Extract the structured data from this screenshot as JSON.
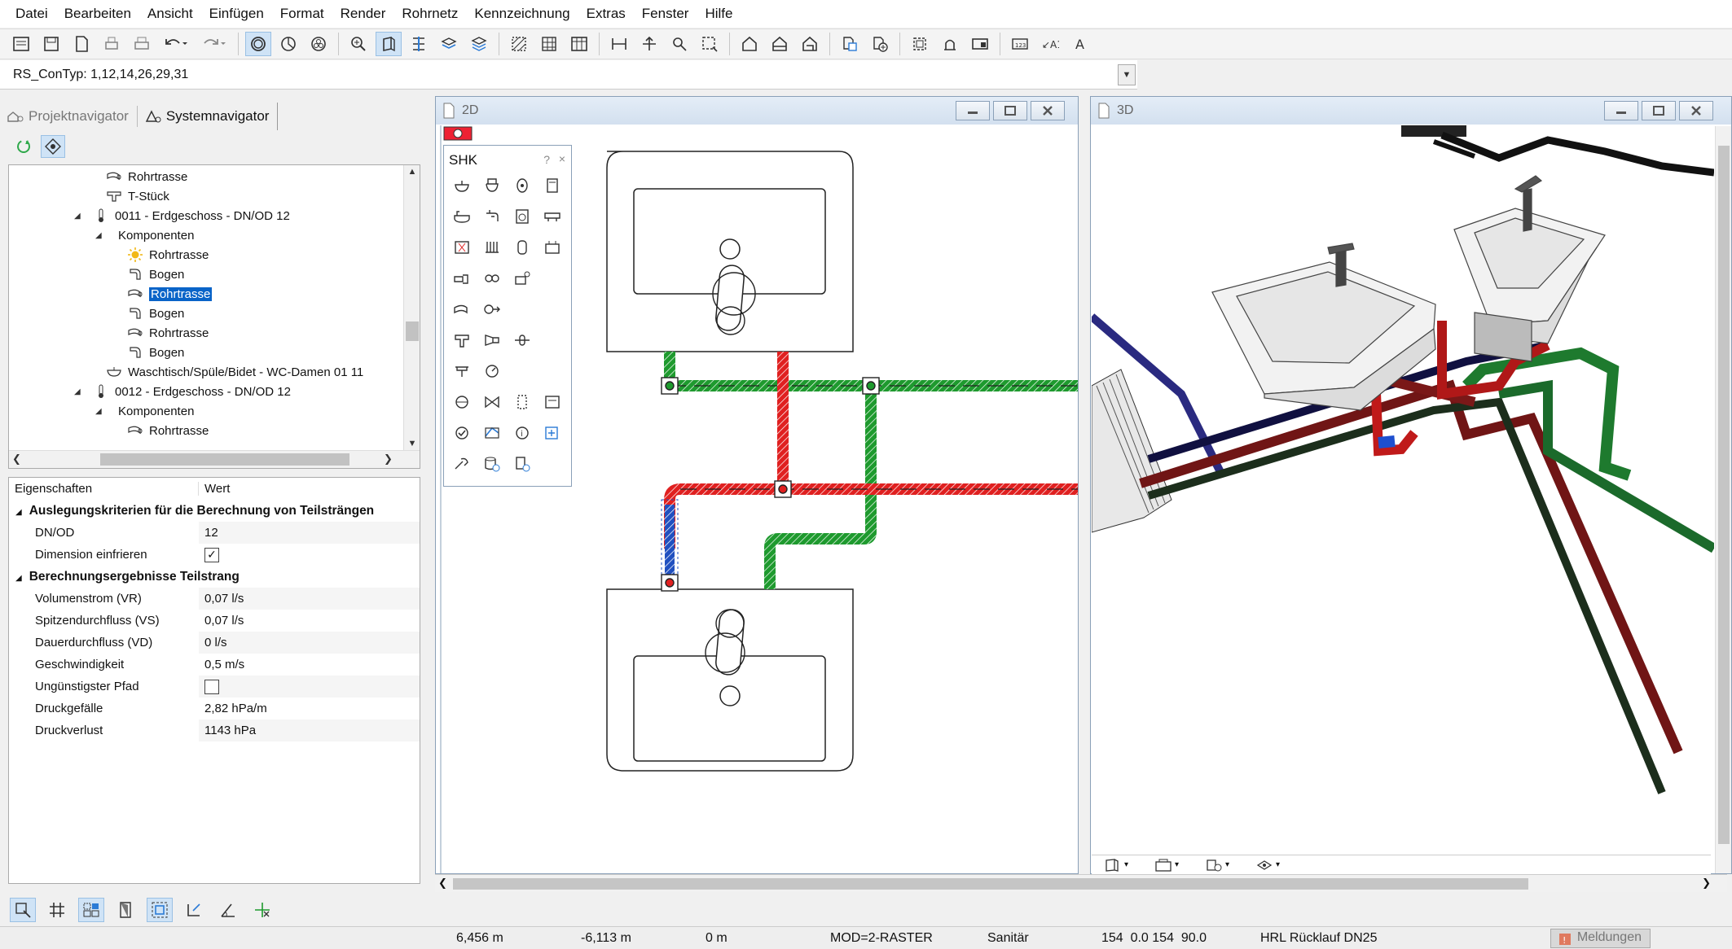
{
  "menu": [
    "Datei",
    "Bearbeiten",
    "Ansicht",
    "Einfügen",
    "Format",
    "Render",
    "Rohrnetz",
    "Kennzeichnung",
    "Extras",
    "Fenster",
    "Hilfe"
  ],
  "property_line": {
    "value": "RS_ConTyp: 1,12,14,26,29,31"
  },
  "navigator": {
    "tabs": [
      {
        "label": "Projektnavigator"
      },
      {
        "label": "Systemnavigator"
      }
    ],
    "tree": [
      {
        "label": "Rohrtrasse",
        "icon": "pipe-route-icon"
      },
      {
        "label": "T-Stück",
        "icon": "tee-fitting-icon"
      },
      {
        "label": "0011 - Erdgeschoss - DN/OD 12",
        "icon": "thermometer-icon"
      },
      {
        "label": "Komponenten",
        "icon": ""
      },
      {
        "label": "Rohrtrasse",
        "icon": "sun-icon"
      },
      {
        "label": "Bogen",
        "icon": "bend-icon"
      },
      {
        "label": "Rohrtrasse",
        "icon": "pipe-route-icon",
        "selected": true
      },
      {
        "label": "Bogen",
        "icon": "bend-icon"
      },
      {
        "label": "Rohrtrasse",
        "icon": "pipe-route-icon"
      },
      {
        "label": "Bogen",
        "icon": "bend-icon"
      },
      {
        "label": "Waschtisch/Spüle/Bidet - WC-Damen 01 11",
        "icon": "washbasin-icon"
      },
      {
        "label": "0012 - Erdgeschoss - DN/OD 12",
        "icon": "thermometer-icon"
      },
      {
        "label": "Komponenten",
        "icon": ""
      },
      {
        "label": "Rohrtrasse",
        "icon": "pipe-route-icon"
      }
    ]
  },
  "properties": {
    "header_key": "Eigenschaften",
    "header_value": "Wert",
    "group1": "Auslegungskriterien für die Berechnung von Teilsträngen",
    "dnod_label": "DN/OD",
    "dnod_value": "12",
    "freeze_label": "Dimension einfrieren",
    "freeze_checked": true,
    "group2": "Berechnungsergebnisse Teilstrang",
    "rows": [
      {
        "label": "Volumenstrom (VR)",
        "value": "0,07 l/s"
      },
      {
        "label": "Spitzendurchfluss (VS)",
        "value": "0,07 l/s"
      },
      {
        "label": "Dauerdurchfluss (VD)",
        "value": "0 l/s"
      },
      {
        "label": "Geschwindigkeit",
        "value": "0,5 m/s"
      }
    ],
    "worst_path_label": "Ungünstigster Pfad",
    "worst_path_checked": false,
    "rows2": [
      {
        "label": "Druckgefälle",
        "value": "2,82 hPa/m"
      },
      {
        "label": "Druckverlust",
        "value": "1143 hPa"
      }
    ]
  },
  "win2d": {
    "title": "2D"
  },
  "win3d": {
    "title": "3D"
  },
  "shk": {
    "title": "SHK",
    "help": "?",
    "close": "×"
  },
  "status": {
    "x": "6,456 m",
    "y": "-6,113 m",
    "z": "0 m",
    "mode": "MOD=2-RASTER",
    "layer": "Sanitär",
    "pen": "154  0.0 154  90.0",
    "style": "HRL Rücklauf DN25",
    "messages": "Meldungen"
  },
  "colors": {
    "selection": "#0a64c8",
    "hot": "#e02020",
    "cold": "#1e9a2e",
    "circ": "#2050c0",
    "accent": "#cfe3f6"
  }
}
